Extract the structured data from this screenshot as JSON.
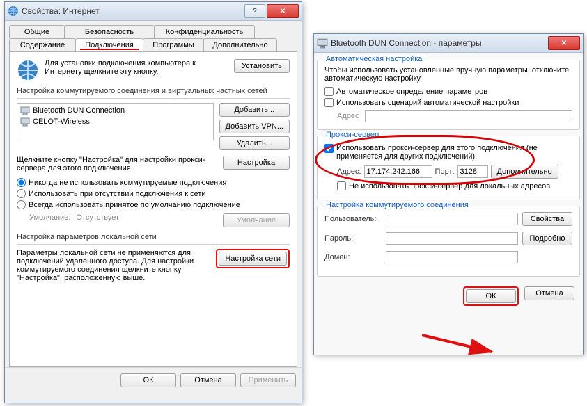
{
  "dialog1": {
    "title": "Свойства: Интернет",
    "tabs": {
      "row1": [
        "Общие",
        "Безопасность",
        "Конфиденциальность"
      ],
      "row2": [
        "Содержание",
        "Подключения",
        "Программы",
        "Дополнительно"
      ]
    },
    "install_text": "Для установки подключения компьютера к Интернету щелкните эту кнопку.",
    "btn_install": "Установить",
    "dial_hdr": "Настройка коммутируемого соединения и виртуальных частных сетей",
    "list": [
      "Bluetooth DUN Connection",
      "CELOT-Wireless"
    ],
    "btn_add": "Добавить...",
    "btn_addvpn": "Добавить VPN...",
    "btn_del": "Удалить...",
    "settings_text": "Щелкните кнопку \"Настройка\" для настройки прокси-сервера для этого подключения.",
    "btn_settings": "Настройка",
    "radio1": "Никогда не использовать коммутируемые подключения",
    "radio2": "Использовать при отсутствии подключения к сети",
    "radio3": "Всегда использовать принятое по умолчанию подключение",
    "default_lbl": "Умолчание:",
    "default_val": "Отсутствует",
    "btn_default": "Умолчание",
    "lan_hdr": "Настройка параметров локальной сети",
    "lan_text": "Параметры локальной сети не применяются для подключений удаленного доступа. Для настройки коммутируемого соединения щелкните кнопку \"Настройка\", расположенную выше.",
    "btn_lan": "Настройка сети",
    "btn_ok": "ОК",
    "btn_cancel": "Отмена",
    "btn_apply": "Применить"
  },
  "dialog2": {
    "title": "Bluetooth DUN Connection - параметры",
    "auto_hdr": "Автоматическая настройка",
    "auto_text": "Чтобы использовать установленные вручную параметры, отключите автоматическую настройку.",
    "chk_auto": "Автоматическое определение параметров",
    "chk_script": "Использовать сценарий автоматической настройки",
    "lbl_addr": "Адрес",
    "proxy_hdr": "Прокси-сервер",
    "chk_proxy": "Использовать прокси-сервер для этого подключения (не применяется для других подключений).",
    "lbl_paddr": "Адрес:",
    "val_paddr": "17.174.242.166",
    "lbl_port": "Порт:",
    "val_port": "3128",
    "btn_more": "Дополнительно",
    "chk_bypass": "Не использовать прокси-сервер для локальных адресов",
    "dial_hdr": "Настройка коммутируемого соединения",
    "lbl_user": "Пользователь:",
    "lbl_pass": "Пароль:",
    "lbl_domain": "Домен:",
    "btn_props": "Свойства",
    "btn_detail": "Подробно",
    "btn_ok": "ОК",
    "btn_cancel": "Отмена"
  }
}
